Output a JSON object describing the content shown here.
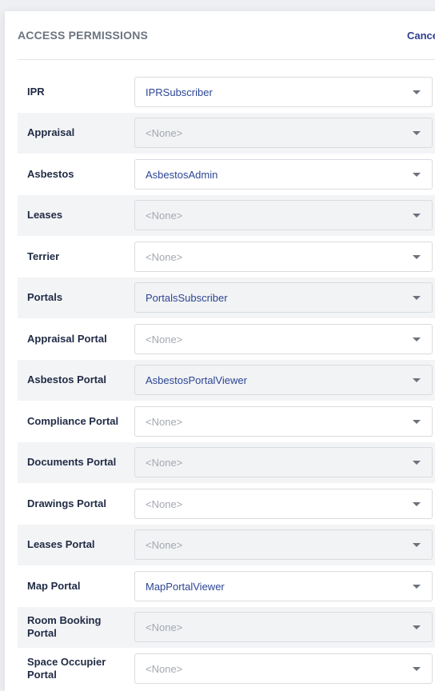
{
  "header": {
    "title": "ACCESS PERMISSIONS",
    "cancel_label": "Cancel"
  },
  "rows": [
    {
      "label": "IPR",
      "value": "IPRSubscriber",
      "is_none": false
    },
    {
      "label": "Appraisal",
      "value": "<None>",
      "is_none": true
    },
    {
      "label": "Asbestos",
      "value": "AsbestosAdmin",
      "is_none": false
    },
    {
      "label": "Leases",
      "value": "<None>",
      "is_none": true
    },
    {
      "label": "Terrier",
      "value": "<None>",
      "is_none": true
    },
    {
      "label": "Portals",
      "value": "PortalsSubscriber",
      "is_none": false
    },
    {
      "label": "Appraisal Portal",
      "value": "<None>",
      "is_none": true
    },
    {
      "label": "Asbestos Portal",
      "value": "AsbestosPortalViewer",
      "is_none": false
    },
    {
      "label": "Compliance Portal",
      "value": "<None>",
      "is_none": true
    },
    {
      "label": "Documents Portal",
      "value": "<None>",
      "is_none": true
    },
    {
      "label": "Drawings Portal",
      "value": "<None>",
      "is_none": true
    },
    {
      "label": "Leases Portal",
      "value": "<None>",
      "is_none": true
    },
    {
      "label": "Map Portal",
      "value": "MapPortalViewer",
      "is_none": false
    },
    {
      "label": "Room Booking Portal",
      "value": "<None>",
      "is_none": true
    },
    {
      "label": "Space Occupier Portal",
      "value": "<None>",
      "is_none": true
    }
  ],
  "icons": {
    "dropdown": "chevron-down-icon"
  },
  "colors": {
    "value_text": "#2c4694",
    "placeholder_text": "#a3a8b0",
    "cancel": "#2c3e91",
    "stripe": "#f3f4f6"
  }
}
